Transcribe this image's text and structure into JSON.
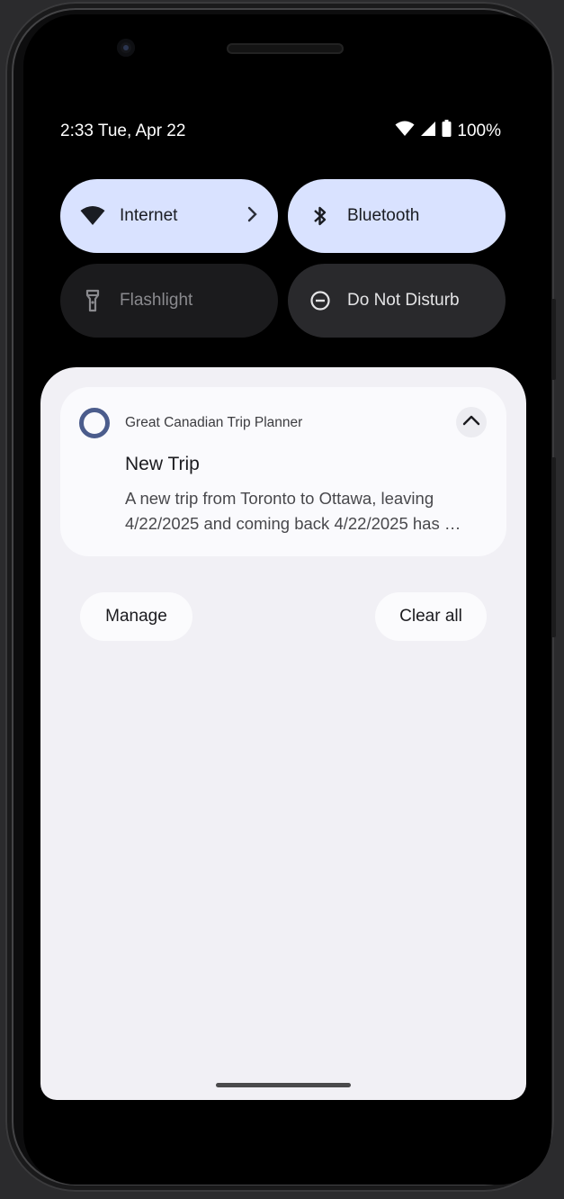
{
  "status_bar": {
    "time_date": "2:33 Tue, Apr 22",
    "battery": "100%",
    "icons": [
      "wifi-icon",
      "signal-icon",
      "battery-icon"
    ]
  },
  "quick_tiles": [
    {
      "label": "Internet",
      "icon": "wifi-icon",
      "state": "on"
    },
    {
      "label": "Bluetooth",
      "icon": "bluetooth-icon",
      "state": "on"
    },
    {
      "label": "Flashlight",
      "icon": "flashlight-icon",
      "state": "unavailable"
    },
    {
      "label": "Do Not Disturb",
      "icon": "dnd-icon",
      "state": "off"
    }
  ],
  "notification": {
    "app_name": "Great Canadian Trip Planner",
    "title": "New Trip",
    "body_line1": "A new trip from Toronto to Ottawa, leaving",
    "body_line2": "4/22/2025 and coming back 4/22/2025 has …",
    "icon": "app-ring-icon",
    "accent": "#4b5c8c"
  },
  "actions": {
    "manage_label": "Manage",
    "clear_all_label": "Clear all"
  },
  "colors": {
    "tile_on": "#d9e2ff",
    "tile_off": "#29292c",
    "shade_bg": "#f1f0f5"
  }
}
